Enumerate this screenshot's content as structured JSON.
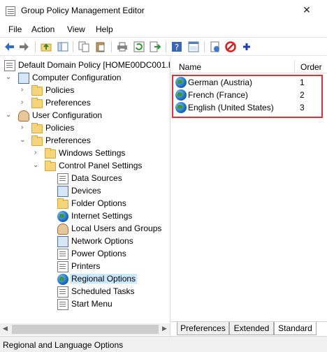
{
  "window": {
    "title": "Group Policy Management Editor"
  },
  "menu": [
    "File",
    "Action",
    "View",
    "Help"
  ],
  "toolbar": {
    "icons": [
      "back-icon",
      "forward-icon",
      "up-folder-icon",
      "show-hide-tree-icon",
      "copy-icon",
      "paste-icon",
      "print-icon",
      "refresh-icon",
      "export-icon",
      "help-icon",
      "properties-icon",
      "new-item-icon",
      "disable-icon",
      "add-icon"
    ]
  },
  "tree": {
    "root": "Default Domain Policy [HOME00DC001.H",
    "computer_configuration": "Computer Configuration",
    "cc_policies": "Policies",
    "cc_preferences": "Preferences",
    "user_configuration": "User Configuration",
    "uc_policies": "Policies",
    "uc_preferences": "Preferences",
    "windows_settings": "Windows Settings",
    "control_panel_settings": "Control Panel Settings",
    "cps_items": [
      "Data Sources",
      "Devices",
      "Folder Options",
      "Internet Settings",
      "Local Users and Groups",
      "Network Options",
      "Power Options",
      "Printers",
      "Regional Options",
      "Scheduled Tasks",
      "Start Menu"
    ],
    "selected": "Regional Options"
  },
  "list": {
    "columns": {
      "name": "Name",
      "order": "Order"
    },
    "rows": [
      {
        "name": "German (Austria)",
        "order": "1"
      },
      {
        "name": "French (France)",
        "order": "2"
      },
      {
        "name": "English (United States)",
        "order": "3"
      }
    ]
  },
  "tabs": [
    "Preferences",
    "Extended",
    "Standard"
  ],
  "active_tab": "Standard",
  "status": {
    "text": "Regional and Language Options"
  },
  "colors": {
    "highlight_border": "#e0303a",
    "selection": "#cce8ff"
  }
}
